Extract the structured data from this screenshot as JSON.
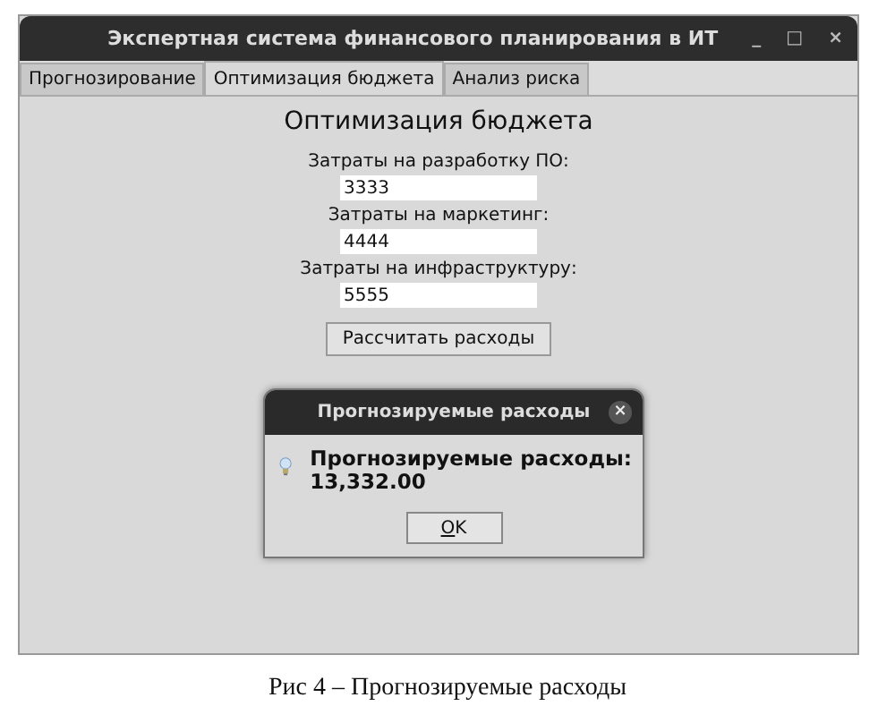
{
  "window": {
    "title": "Экспертная система финансового планирования в ИТ",
    "controls": [
      "_",
      "□",
      "×"
    ]
  },
  "tabs": [
    {
      "label": "Прогнозирование",
      "selected": false
    },
    {
      "label": "Оптимизация бюджета",
      "selected": true
    },
    {
      "label": "Анализ риска",
      "selected": false
    }
  ],
  "panel": {
    "heading": "Оптимизация бюджета",
    "fields": [
      {
        "label": "Затраты на разработку ПО:",
        "value": "3333"
      },
      {
        "label": "Затраты на маркетинг:",
        "value": "4444"
      },
      {
        "label": "Затраты на инфраструктуру:",
        "value": "5555"
      }
    ],
    "button": "Рассчитать расходы"
  },
  "dialog": {
    "title": "Прогнозируемые расходы",
    "close": "×",
    "message": "Прогнозируемые расходы:\n13,332.00",
    "button": {
      "mnemonic": "O",
      "rest": "K"
    }
  },
  "caption": "Рис 4 – Прогнозируемые расходы"
}
